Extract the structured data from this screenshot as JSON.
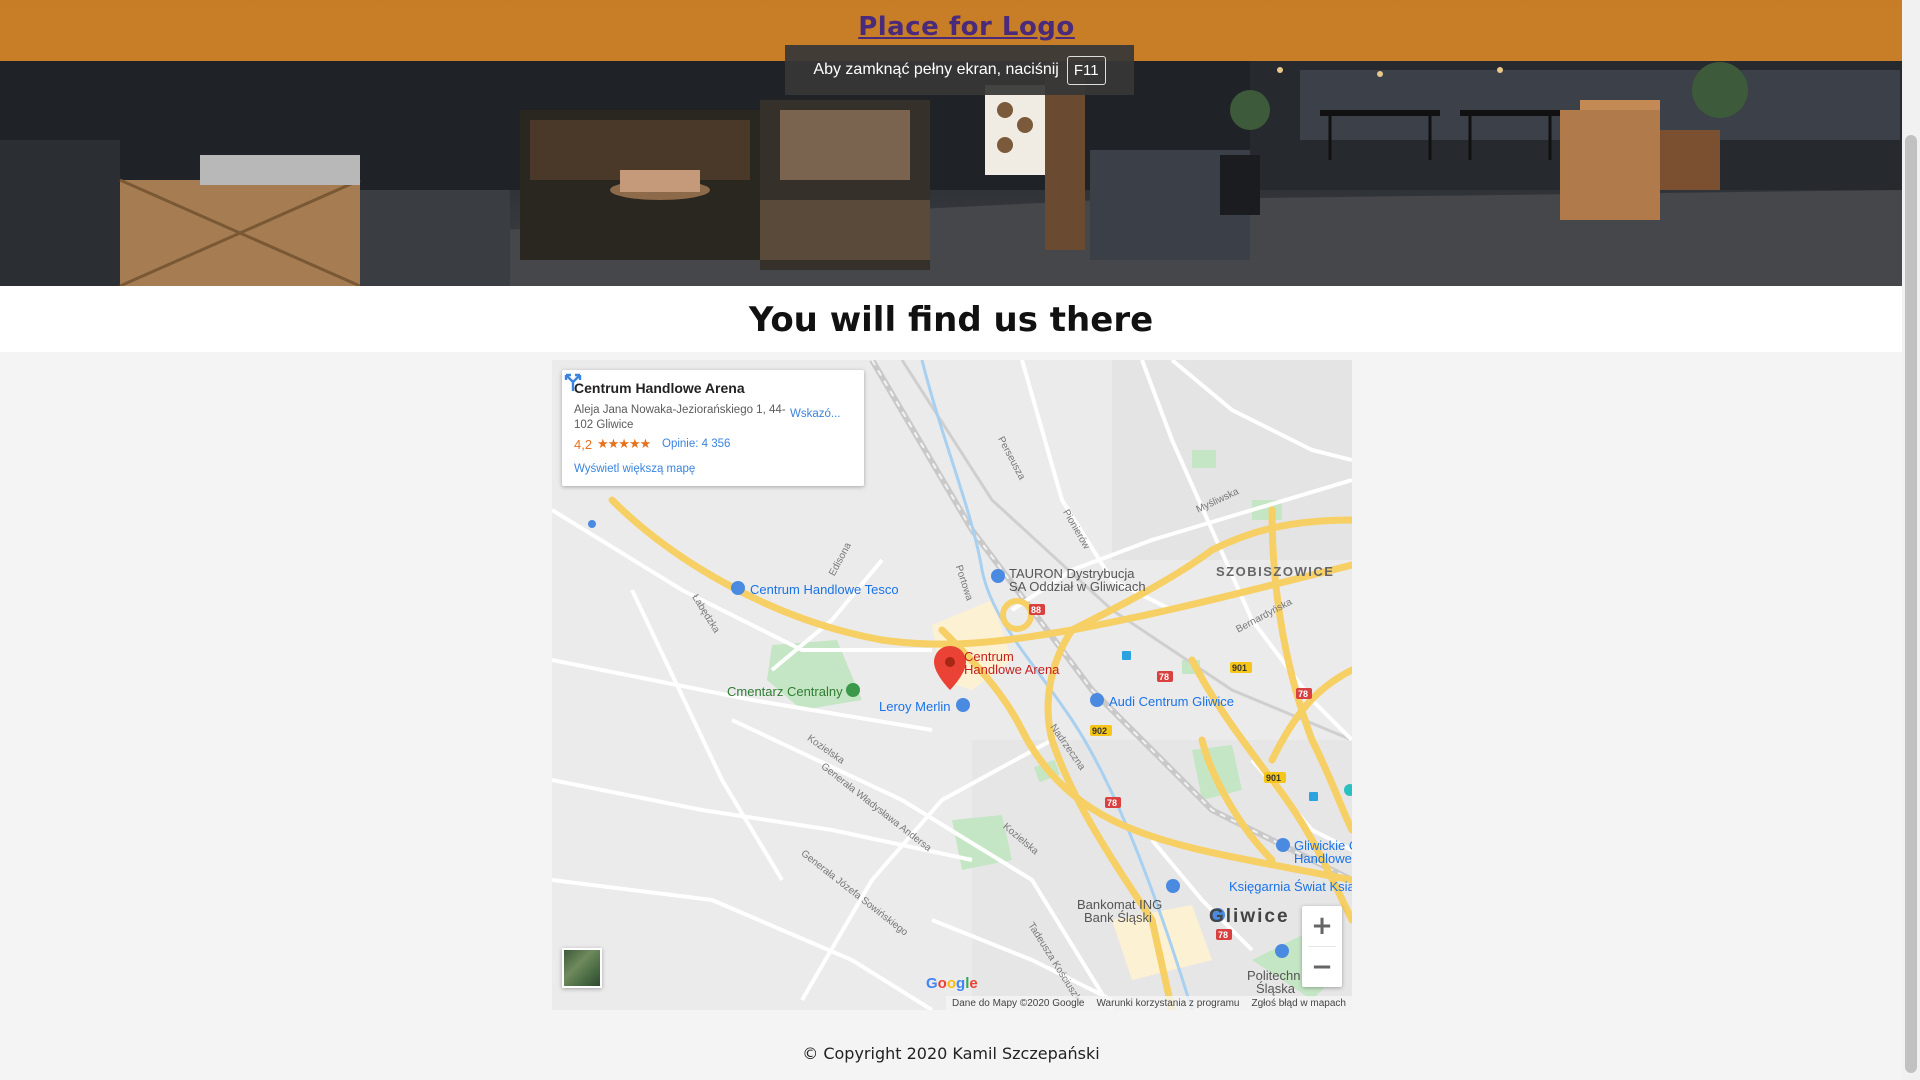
{
  "header": {
    "logo_text": "Place for Logo",
    "fullscreen_notice": "Aby zamknąć pełny ekran, naciśnij",
    "fullscreen_key": "F11"
  },
  "section": {
    "title": "You will find us there"
  },
  "map": {
    "place_card": {
      "name": "Centrum Handlowe Arena",
      "address": "Aleja Jana Nowaka-Jeziorańskiego 1, 44-102 Gliwice",
      "rating": "4,2",
      "stars": "★★★★★",
      "reviews": "Opinie: 4 356",
      "larger_map_link": "Wyświetl większą mapę",
      "directions_label": "Wskazó..."
    },
    "labels": {
      "tesco": "Centrum Handlowe Tesco",
      "tauron_line1": "TAURON Dystrybucja",
      "tauron_line2": "SA Oddział w Gliwicach",
      "szobiszowice": "SZOBISZOWICE",
      "arena_line1": "Centrum",
      "arena_line2": "Handlowe Arena",
      "cmentarz": "Cmentarz Centralny",
      "leroy": "Leroy Merlin",
      "audi": "Audi Centrum Gliwice",
      "bankomat_line1": "Bankomat ING",
      "bankomat_line2": "Bank Śląski",
      "gliwice": "Gliwice",
      "ksiegarnia": "Księgarnia Świat Ksią",
      "gliwickie_line1": "Gliwickie C",
      "gliwickie_line2": "Handlowe",
      "politechnika_line1": "Politechn",
      "politechnika_line2": "Śląska"
    },
    "streets": {
      "perseusza": "Perseusza",
      "pionierow": "Pionierów",
      "mysliwska": "Myśliwska",
      "portowa": "Portowa",
      "edisona": "Edisona",
      "labedzka": "Łabędzka",
      "bernardynska": "Bernardyńska",
      "kozielska": "Kozielska",
      "andersa": "Generała Władysława Andersa",
      "kozielska2": "Kozielska",
      "nadrzeczna": "Nadrzeczna",
      "sowinskiego": "Generała Józefa Sowińskiego",
      "kosciuszki": "Tadeusza Kościuszki"
    },
    "road_numbers": {
      "r88": "88",
      "r78a": "78",
      "r78b": "78",
      "r78c": "78",
      "r78d": "78",
      "r901a": "901",
      "r901b": "901",
      "r902": "902"
    },
    "zoom_in": "+",
    "zoom_out": "−",
    "google_logo": "Google",
    "attribution": {
      "data": "Dane do Mapy ©2020 Google",
      "terms": "Warunki korzystania z programu",
      "report": "Zgłoś błąd w mapach"
    }
  },
  "footer": {
    "copyright": "© Copyright 2020 Kamil Szczepański"
  },
  "colors": {
    "topbar": "#ee9228",
    "logo": "#4a2a7a",
    "map_road_major": "#f6cf65",
    "map_link": "#3a84df",
    "pin": "#ea4335"
  }
}
